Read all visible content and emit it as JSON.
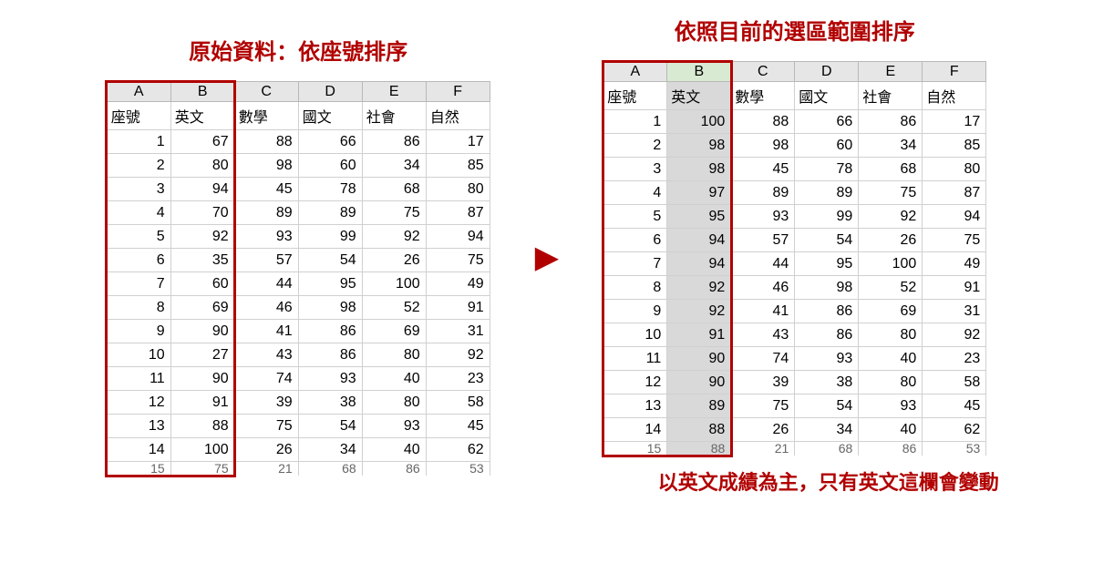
{
  "labels": {
    "left_heading": "原始資料：依座號排序",
    "right_heading": "依照目前的選區範圍排序",
    "right_caption": "以英文成績為主，只有英文這欄會變動",
    "arrow": "▶"
  },
  "columns": [
    "A",
    "B",
    "C",
    "D",
    "E",
    "F"
  ],
  "header_row": [
    "座號",
    "英文",
    "數學",
    "國文",
    "社會",
    "自然"
  ],
  "left_rows": [
    [
      1,
      67,
      88,
      66,
      86,
      17
    ],
    [
      2,
      80,
      98,
      60,
      34,
      85
    ],
    [
      3,
      94,
      45,
      78,
      68,
      80
    ],
    [
      4,
      70,
      89,
      89,
      75,
      87
    ],
    [
      5,
      92,
      93,
      99,
      92,
      94
    ],
    [
      6,
      35,
      57,
      54,
      26,
      75
    ],
    [
      7,
      60,
      44,
      95,
      100,
      49
    ],
    [
      8,
      69,
      46,
      98,
      52,
      91
    ],
    [
      9,
      90,
      41,
      86,
      69,
      31
    ],
    [
      10,
      27,
      43,
      86,
      80,
      92
    ],
    [
      11,
      90,
      74,
      93,
      40,
      23
    ],
    [
      12,
      91,
      39,
      38,
      80,
      58
    ],
    [
      13,
      88,
      75,
      54,
      93,
      45
    ],
    [
      14,
      100,
      26,
      34,
      40,
      62
    ]
  ],
  "left_cut_row": [
    15,
    75,
    21,
    68,
    86,
    53
  ],
  "right_rows": [
    [
      1,
      100,
      88,
      66,
      86,
      17
    ],
    [
      2,
      98,
      98,
      60,
      34,
      85
    ],
    [
      3,
      98,
      45,
      78,
      68,
      80
    ],
    [
      4,
      97,
      89,
      89,
      75,
      87
    ],
    [
      5,
      95,
      93,
      99,
      92,
      94
    ],
    [
      6,
      94,
      57,
      54,
      26,
      75
    ],
    [
      7,
      94,
      44,
      95,
      100,
      49
    ],
    [
      8,
      92,
      46,
      98,
      52,
      91
    ],
    [
      9,
      92,
      41,
      86,
      69,
      31
    ],
    [
      10,
      91,
      43,
      86,
      80,
      92
    ],
    [
      11,
      90,
      74,
      93,
      40,
      23
    ],
    [
      12,
      90,
      39,
      38,
      80,
      58
    ],
    [
      13,
      89,
      75,
      54,
      93,
      45
    ],
    [
      14,
      88,
      26,
      34,
      40,
      62
    ]
  ],
  "right_cut_row": [
    15,
    88,
    21,
    68,
    86,
    53
  ]
}
